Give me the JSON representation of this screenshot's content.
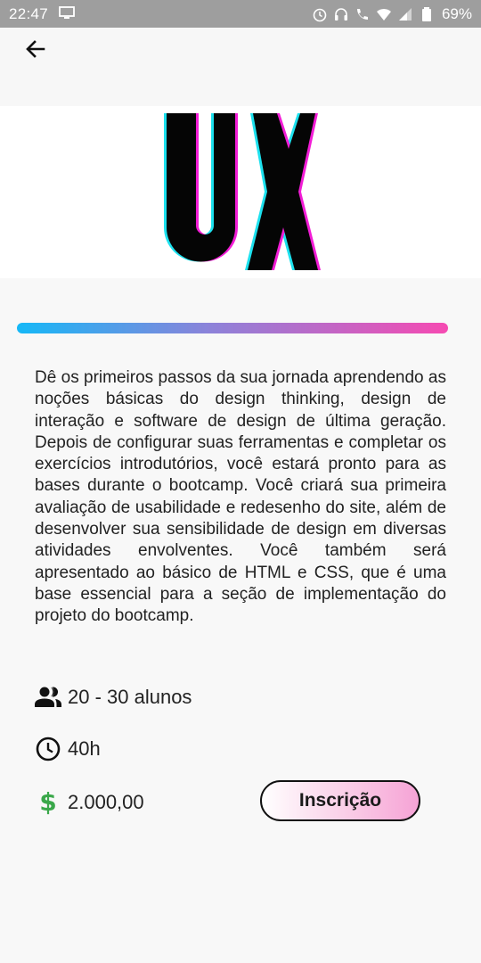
{
  "status_bar": {
    "time": "22:47",
    "battery_percent": "69%",
    "icons": [
      "screen-icon",
      "alarm-icon",
      "headset-icon",
      "volte-call-icon",
      "wifi-icon",
      "signal-icon",
      "battery-icon"
    ]
  },
  "app_bar": {
    "back_icon": "arrow-back-icon"
  },
  "hero": {
    "logo_text": "UX"
  },
  "colors": {
    "gradient_start": "#15b8f7",
    "gradient_end": "#f64ab2",
    "price_icon": "#3aa84a"
  },
  "course": {
    "description": "Dê os primeiros passos da sua jornada aprendendo as noções básicas do design thinking, design de interação e software de design de última geração. Depois de configurar suas ferramentas e completar os exercícios introdutórios, você estará pronto para as bases durante o bootcamp. Você criará sua primeira avaliação de usabilidade e redesenho do site, além de desenvolver sua sensibilidade de design em diversas atividades envolventes. Você também será apresentado ao básico de HTML e CSS, que é uma base essencial para a seção de implementação do projeto do bootcamp.",
    "students": "20 - 30 alunos",
    "hours": "40h",
    "price_symbol": "$",
    "price": "2.000,00",
    "enroll_label": "Inscrição"
  }
}
